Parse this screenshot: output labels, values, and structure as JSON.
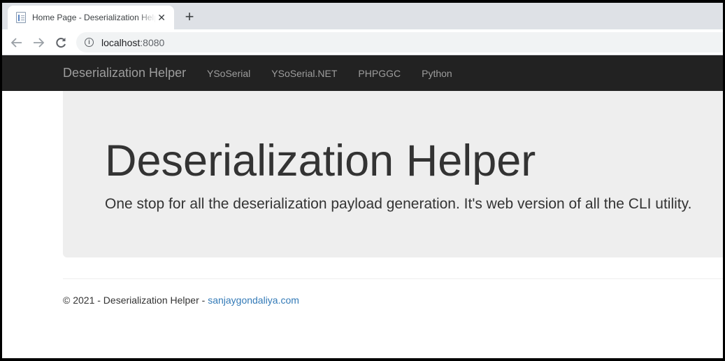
{
  "browser": {
    "tab_title": "Home Page - Deserialization Helper",
    "url_host": "localhost",
    "url_port": ":8080",
    "icons": [
      "document-favicon",
      "close-icon",
      "new-tab-icon",
      "back-arrow-icon",
      "forward-arrow-icon",
      "reload-icon",
      "info-icon"
    ]
  },
  "navbar": {
    "brand": "Deserialization Helper",
    "links": [
      "YSoSerial",
      "YSoSerial.NET",
      "PHPGGC",
      "Python"
    ]
  },
  "jumbotron": {
    "heading": "Deserialization Helper",
    "lead": "One stop for all the deserialization payload generation. It's web version of all the CLI utility."
  },
  "footer": {
    "text": "© 2021 - Deserialization Helper - ",
    "link": "sanjaygondaliya.com"
  },
  "colors": {
    "navbar_bg": "#222222",
    "jumbotron_bg": "#eeeeee",
    "link": "#337ab7"
  }
}
